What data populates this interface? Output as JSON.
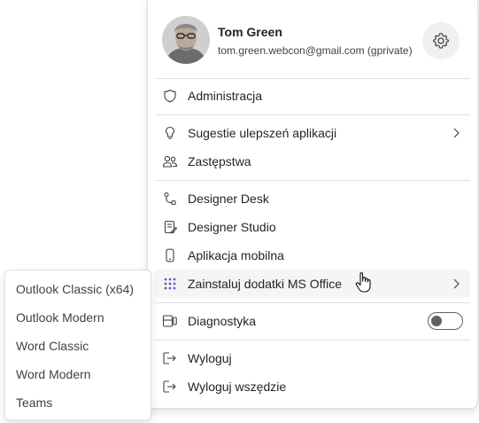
{
  "profile": {
    "name": "Tom Green",
    "email": "tom.green.webcon@gmail.com (gprivate)"
  },
  "menu": {
    "administracja": "Administracja",
    "sugestie": "Sugestie ulepszeń aplikacji",
    "zastepstwa": "Zastępstwa",
    "designer_desk": "Designer Desk",
    "designer_studio": "Designer Studio",
    "aplikacja_mobilna": "Aplikacja mobilna",
    "zainstaluj": "Zainstaluj dodatki MS Office",
    "diagnostyka": "Diagnostyka",
    "diagnostyka_enabled": false,
    "wyloguj": "Wyloguj",
    "wyloguj_wszedzie": "Wyloguj wszędzie"
  },
  "submenu": {
    "items": [
      "Outlook Classic (x64)",
      "Outlook Modern",
      "Word Classic",
      "Word Modern",
      "Teams"
    ]
  },
  "icons": {
    "settings": "gear-icon",
    "administracja": "shield-icon",
    "sugestie": "lightbulb-icon",
    "zastepstwa": "people-icon",
    "designer_desk": "flow-icon",
    "designer_studio": "document-edit-icon",
    "aplikacja_mobilna": "phone-icon",
    "zainstaluj": "apps-grid-icon",
    "diagnostyka": "diagnostics-icon",
    "wyloguj": "sign-out-icon"
  },
  "colors": {
    "accent": "#5b5fc7",
    "text": "#242424",
    "divider": "#e0e0e0",
    "hover": "#f5f5f5"
  }
}
